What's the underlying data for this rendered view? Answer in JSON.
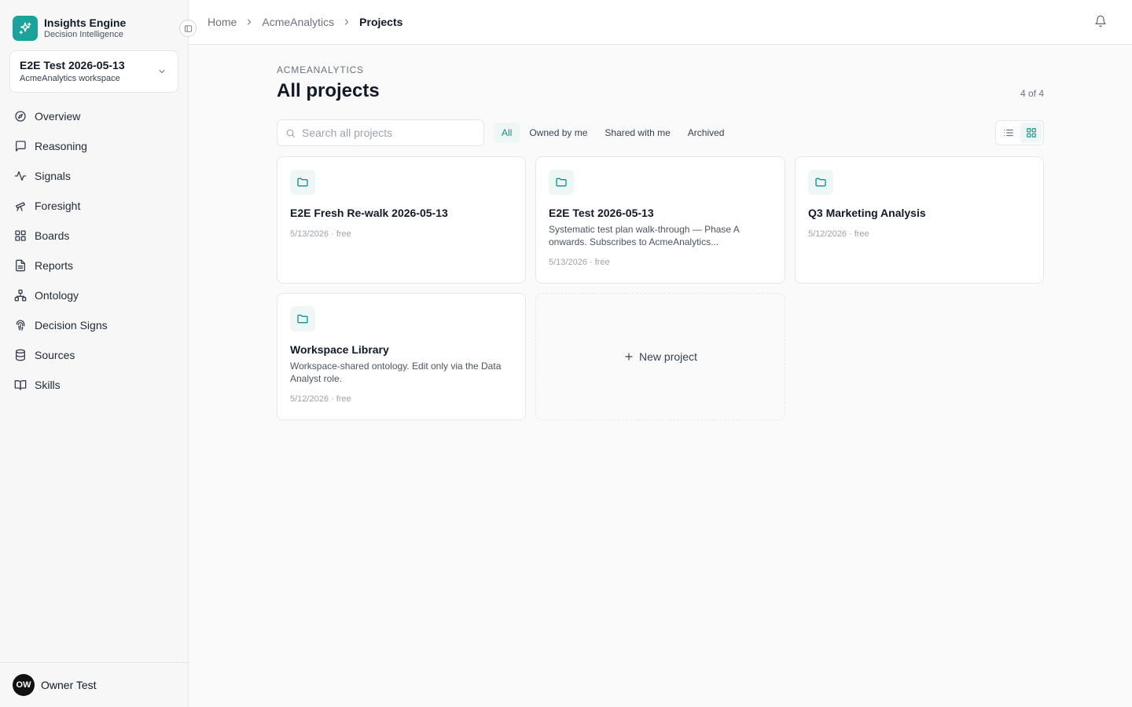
{
  "brand": {
    "name": "Insights Engine",
    "subtitle": "Decision Intelligence",
    "color": "#1aa39a"
  },
  "workspace": {
    "title": "E2E Test 2026-05-13",
    "subtitle": "AcmeAnalytics workspace"
  },
  "nav": [
    {
      "label": "Overview",
      "icon": "compass-icon"
    },
    {
      "label": "Reasoning",
      "icon": "message-icon"
    },
    {
      "label": "Signals",
      "icon": "activity-icon"
    },
    {
      "label": "Foresight",
      "icon": "telescope-icon"
    },
    {
      "label": "Boards",
      "icon": "grid-icon"
    },
    {
      "label": "Reports",
      "icon": "file-text-icon"
    },
    {
      "label": "Ontology",
      "icon": "network-icon"
    },
    {
      "label": "Decision Signs",
      "icon": "fingerprint-icon"
    },
    {
      "label": "Sources",
      "icon": "database-icon"
    },
    {
      "label": "Skills",
      "icon": "book-icon"
    }
  ],
  "user": {
    "initials": "OW",
    "name": "Owner Test"
  },
  "breadcrumb": [
    "Home",
    "AcmeAnalytics",
    "Projects"
  ],
  "header": {
    "eyebrow": "ACMEANALYTICS",
    "title": "All projects",
    "count": "4 of 4"
  },
  "search": {
    "placeholder": "Search all projects"
  },
  "filters": [
    {
      "label": "All",
      "active": true
    },
    {
      "label": "Owned by me",
      "active": false
    },
    {
      "label": "Shared with me",
      "active": false
    },
    {
      "label": "Archived",
      "active": false
    }
  ],
  "projects": [
    {
      "title": "E2E Fresh Re-walk 2026-05-13",
      "description": "",
      "meta": "5/13/2026 · free"
    },
    {
      "title": "E2E Test 2026-05-13",
      "description": "Systematic test plan walk-through — Phase A onwards. Subscribes to AcmeAnalytics...",
      "meta": "5/13/2026 · free"
    },
    {
      "title": "Q3 Marketing Analysis",
      "description": "",
      "meta": "5/12/2026 · free"
    },
    {
      "title": "Workspace Library",
      "description": "Workspace-shared ontology. Edit only via the Data Analyst role.",
      "meta": "5/12/2026 · free"
    }
  ],
  "new_project": {
    "label": "New project"
  },
  "colors": {
    "accent": "#1aa39a",
    "accent_bg": "#eef7f6"
  }
}
